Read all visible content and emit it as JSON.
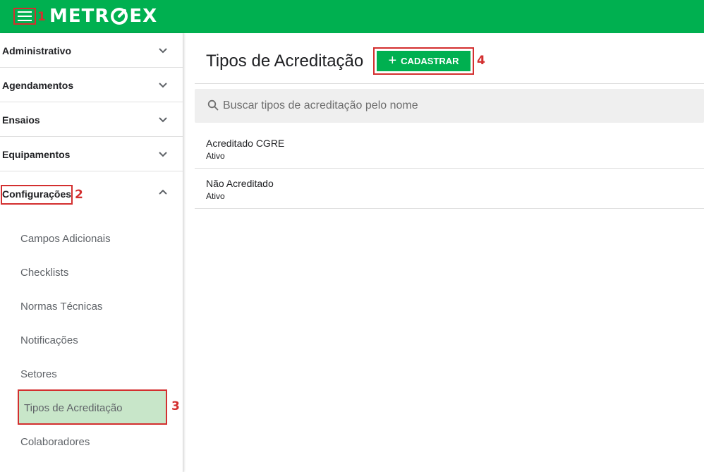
{
  "header": {
    "logo_text_left": "METR",
    "logo_text_right": "EX",
    "menu_badge": "1"
  },
  "sidebar": {
    "sections": [
      {
        "label": "Administrativo"
      },
      {
        "label": "Agendamentos"
      },
      {
        "label": "Ensaios"
      },
      {
        "label": "Equipamentos"
      }
    ],
    "config": {
      "label": "Configurações",
      "badge": "2",
      "items": [
        {
          "label": "Campos Adicionais"
        },
        {
          "label": "Checklists"
        },
        {
          "label": "Normas Técnicas"
        },
        {
          "label": "Notificações"
        },
        {
          "label": "Setores"
        },
        {
          "label": "Tipos de Acreditação"
        },
        {
          "label": "Colaboradores"
        }
      ],
      "active_badge": "3"
    }
  },
  "main": {
    "title": "Tipos de Acreditação",
    "add_button": {
      "plus": "+",
      "label": "CADASTRAR"
    },
    "add_badge": "4",
    "search": {
      "placeholder": "Buscar tipos de acreditação pelo nome",
      "value": ""
    },
    "rows": [
      {
        "title": "Acreditado CGRE",
        "status": "Ativo"
      },
      {
        "title": "Não Acreditado",
        "status": "Ativo"
      }
    ]
  },
  "colors": {
    "brand_green": "#00b050",
    "annotation_red": "#d32f2f",
    "active_item_bg": "#c8e6c9"
  }
}
